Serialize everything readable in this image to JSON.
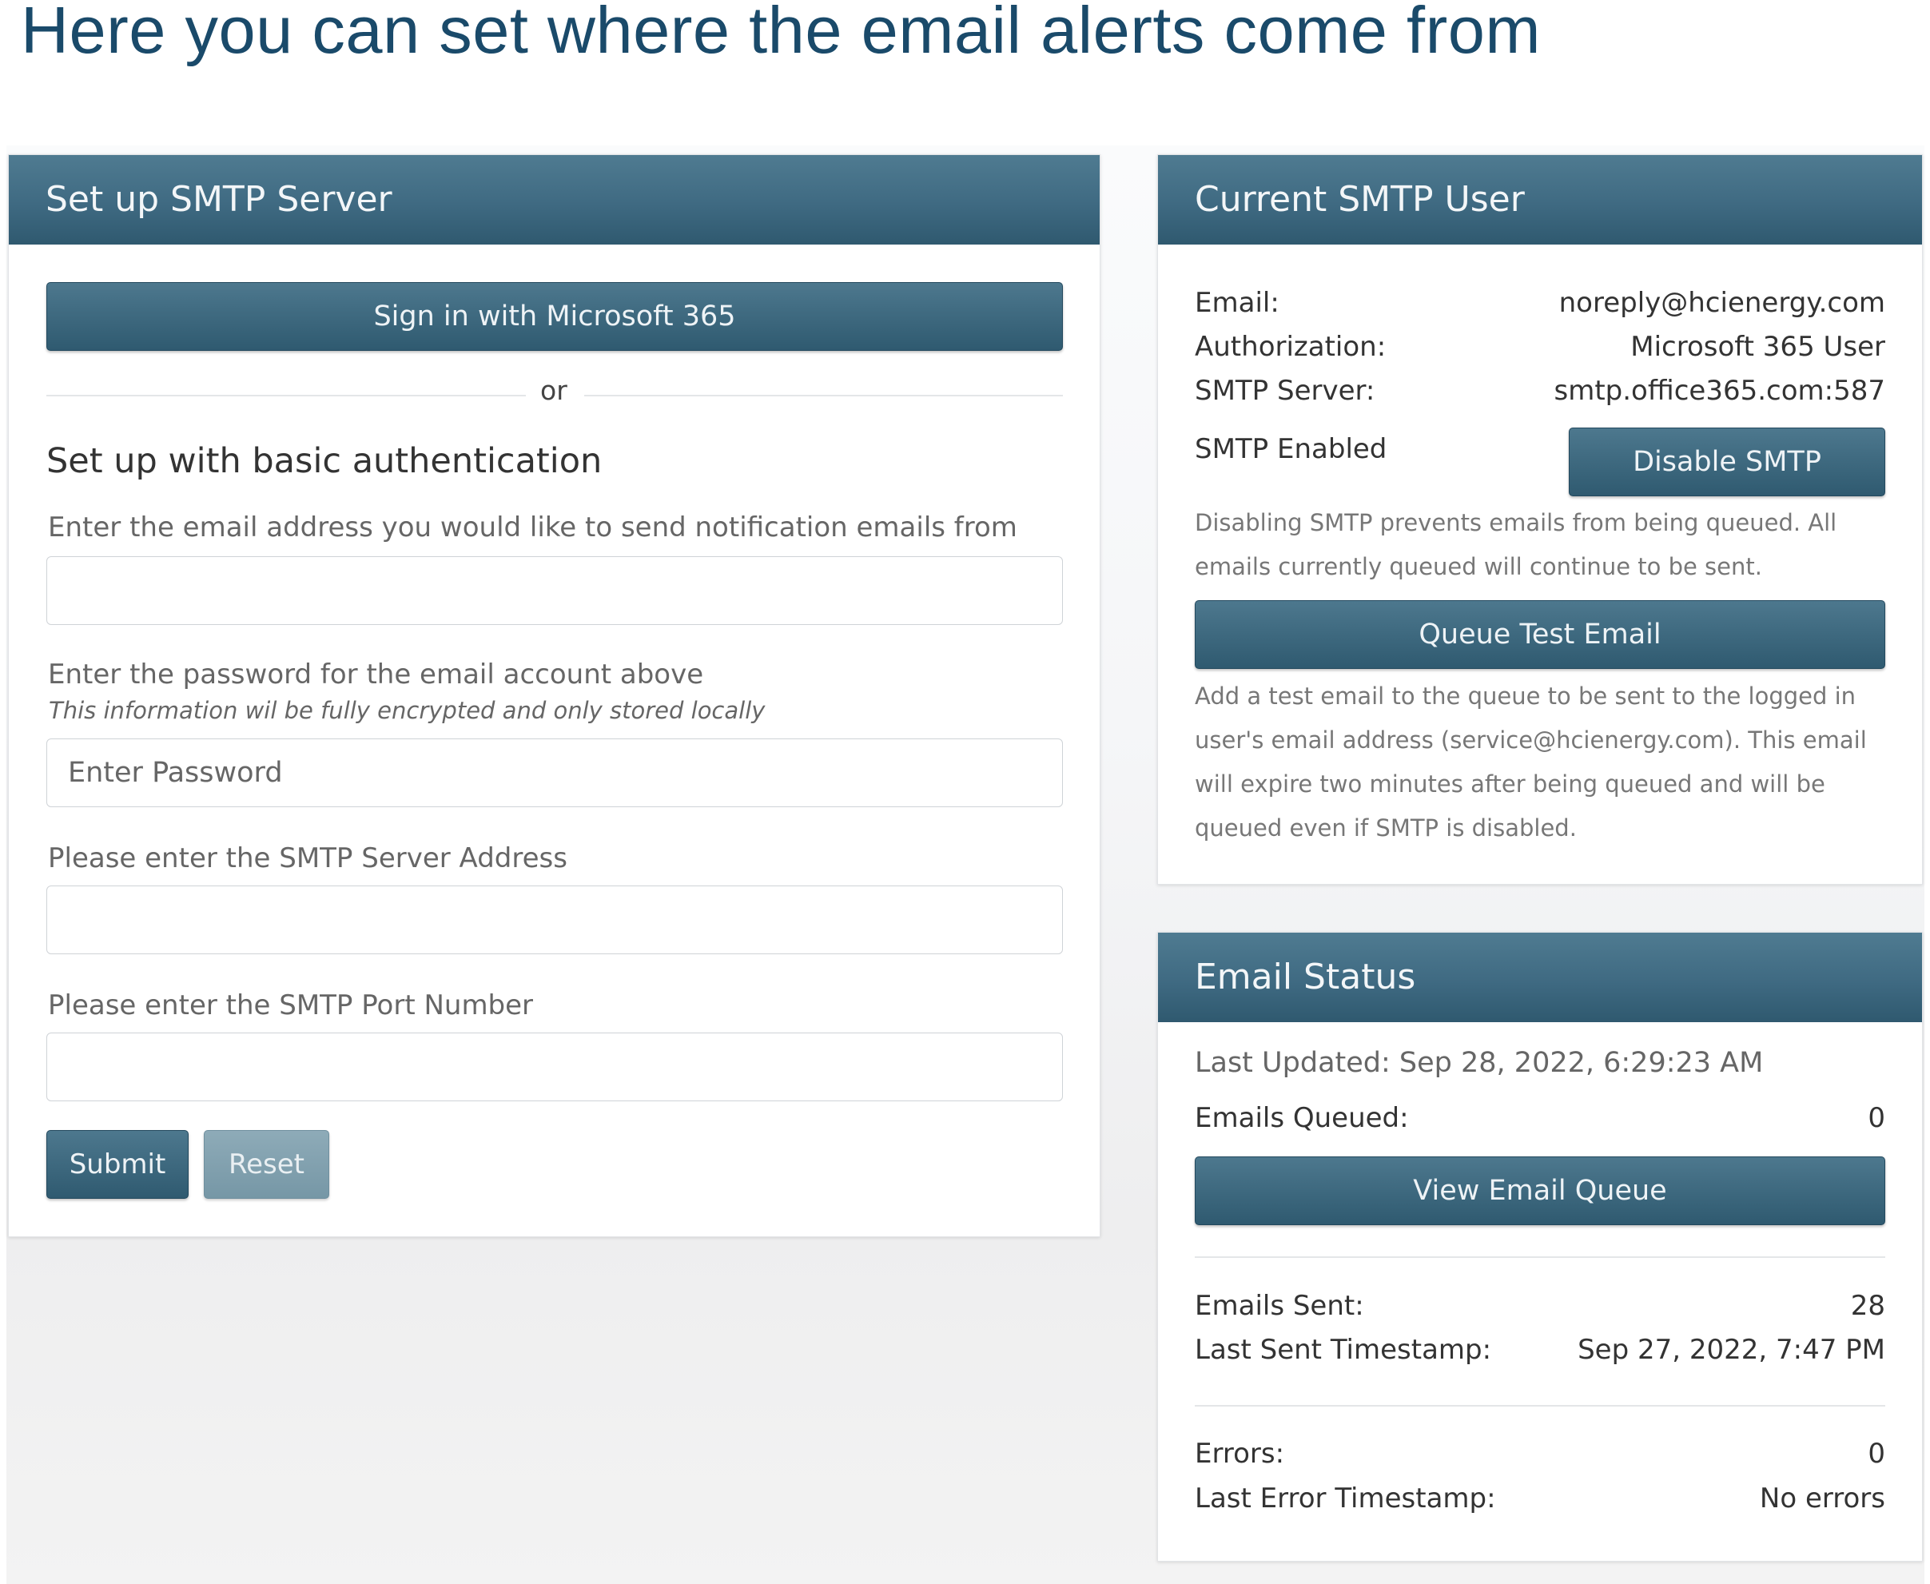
{
  "headline": "Here you can set where the email alerts come from",
  "setup_panel": {
    "title": "Set up SMTP Server",
    "ms_signin_label": "Sign in with Microsoft 365",
    "or_text": "or",
    "basic_auth_heading": "Set up with basic authentication",
    "email_label": "Enter the email address you would like to send notification emails from",
    "email_value": "",
    "password_label": "Enter the password for the email account above",
    "password_hint": "This information wil be fully encrypted and only stored locally",
    "password_placeholder": "Enter Password",
    "server_label": "Please enter the SMTP Server Address",
    "server_value": "",
    "port_label": "Please enter the SMTP Port Number",
    "port_value": "",
    "submit_label": "Submit",
    "reset_label": "Reset"
  },
  "current_user_panel": {
    "title": "Current SMTP User",
    "email_label": "Email:",
    "email_value": "noreply@hcienergy.com",
    "auth_label": "Authorization:",
    "auth_value": "Microsoft 365 User",
    "server_label": "SMTP Server:",
    "server_value": "smtp.office365.com:587",
    "enabled_label": "SMTP Enabled",
    "disable_label": "Disable SMTP",
    "disable_note": "Disabling SMTP prevents emails from being queued. All emails currently queued will continue to be sent.",
    "queue_test_label": "Queue Test Email",
    "test_note": "Add a test email to the queue to be sent to the logged in user's email address (service@hcienergy.com). This email will expire two minutes after being queued and will be queued even if SMTP is disabled."
  },
  "status_panel": {
    "title": "Email Status",
    "last_updated": "Last Updated: Sep 28, 2022, 6:29:23 AM",
    "queued_label": "Emails Queued:",
    "queued_value": "0",
    "view_queue_label": "View Email Queue",
    "sent_label": "Emails Sent:",
    "sent_value": "28",
    "last_sent_label": "Last Sent Timestamp:",
    "last_sent_value": "Sep 27, 2022, 7:47 PM",
    "errors_label": "Errors:",
    "errors_value": "0",
    "last_error_label": "Last Error Timestamp:",
    "last_error_value": "No errors"
  },
  "colors": {
    "headline": "#1a4a6a",
    "header_gradient_top": "#4f7b91",
    "header_gradient_bottom": "#2f596f",
    "reset_button": "#7f9fae"
  }
}
